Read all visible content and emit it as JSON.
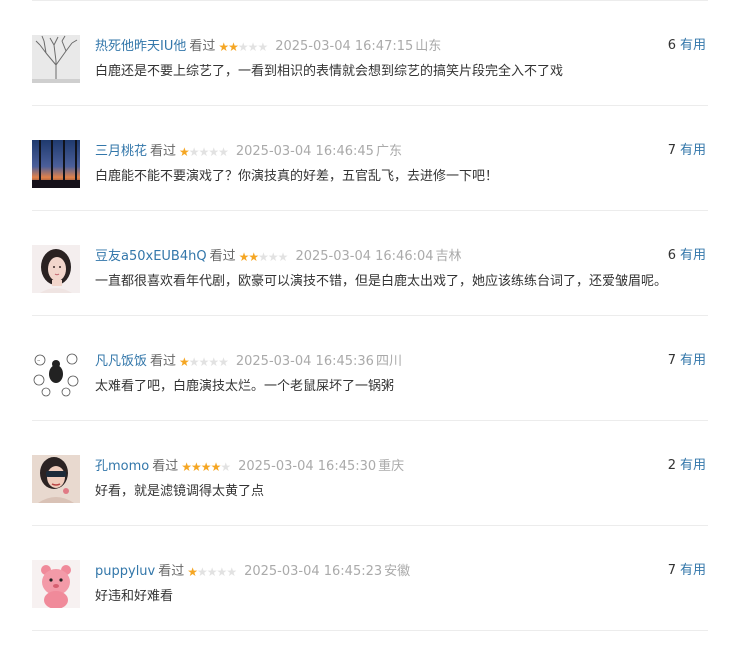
{
  "comments": [
    {
      "user": "热死他昨天IU他",
      "status": "看过",
      "rating": 2,
      "time": "2025-03-04 16:47:15",
      "location": "山东",
      "votes": "6",
      "vote_label": "有用",
      "text": "白鹿还是不要上综艺了，一看到相识的表情就会想到综艺的搞笑片段完全入不了戏",
      "avatar": "bare-tree-avatar"
    },
    {
      "user": "三月桃花",
      "status": "看过",
      "rating": 1,
      "time": "2025-03-04 16:46:45",
      "location": "广东",
      "votes": "7",
      "vote_label": "有用",
      "text": "白鹿能不能不要演戏了？你演技真的好差，五官乱飞，去进修一下吧！",
      "avatar": "sunset-window-avatar"
    },
    {
      "user": "豆友a50xEUB4hQ",
      "status": "看过",
      "rating": 2,
      "time": "2025-03-04 16:46:04",
      "location": "吉林",
      "votes": "6",
      "vote_label": "有用",
      "text": "一直都很喜欢看年代剧，欧豪可以演技不错，但是白鹿太出戏了，她应该练练台词了，还爱皱眉呢。",
      "avatar": "portrait-avatar"
    },
    {
      "user": "凡凡饭饭",
      "status": "看过",
      "rating": 1,
      "time": "2025-03-04 16:45:36",
      "location": "四川",
      "votes": "7",
      "vote_label": "有用",
      "text": "太难看了吧，白鹿演技太烂。一个老鼠屎坏了一锅粥",
      "avatar": "doodle-avatar"
    },
    {
      "user": "孔momo",
      "status": "看过",
      "rating": 4,
      "time": "2025-03-04 16:45:30",
      "location": "重庆",
      "votes": "2",
      "vote_label": "有用",
      "text": "好看，就是滤镜调得太黄了点",
      "avatar": "sunglasses-avatar"
    },
    {
      "user": "puppyluv",
      "status": "看过",
      "rating": 1,
      "time": "2025-03-04 16:45:23",
      "location": "安徽",
      "votes": "7",
      "vote_label": "有用",
      "text": "好违和好难看",
      "avatar": "pink-plush-avatar"
    }
  ],
  "colors": {
    "link": "#3377aa",
    "star": "#f5a623",
    "meta": "#aaaaaa",
    "text": "#333333"
  }
}
